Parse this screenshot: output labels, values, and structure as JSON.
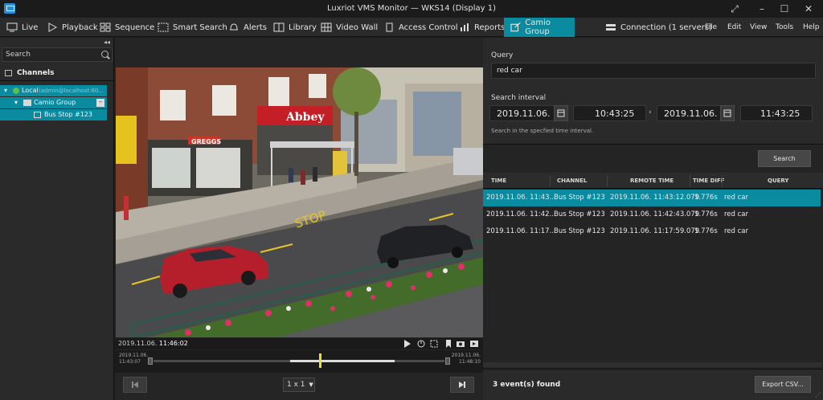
{
  "window": {
    "title": "Luxriot VMS Monitor — WKS14 (Display 1)"
  },
  "menu": {
    "tabs": [
      {
        "label": "Live",
        "icon": "monitor-icon"
      },
      {
        "label": "Playback",
        "icon": "play-icon"
      },
      {
        "label": "Sequence",
        "icon": "grid-icon"
      },
      {
        "label": "Smart Search",
        "icon": "smart-search-icon"
      },
      {
        "label": "Alerts",
        "icon": "bell-icon"
      },
      {
        "label": "Library",
        "icon": "library-icon"
      },
      {
        "label": "Video Wall",
        "icon": "video-wall-icon"
      },
      {
        "label": "Access Control",
        "icon": "door-icon"
      },
      {
        "label": "Reports",
        "icon": "chart-icon"
      },
      {
        "label": "Camio Group",
        "icon": "external-link-icon"
      }
    ],
    "connection": "Connection (1 servers)",
    "menus": [
      "File",
      "Edit",
      "View",
      "Tools",
      "Help"
    ]
  },
  "sidebar": {
    "search_placeholder": "Search",
    "channels_label": "Channels",
    "tree": [
      {
        "label": "Local",
        "sub": "(admin@localhost:60..."
      },
      {
        "label": "Camio Group"
      },
      {
        "label": "Bus Stop #123"
      }
    ]
  },
  "video": {
    "timestamp": {
      "date": "2019.11.06.",
      "time": "11:46:02"
    },
    "timeline": {
      "start_date": "2019.11.06.",
      "start_time": "11:43:07",
      "end_date": "2019.11.06.",
      "end_time": "11:48:10"
    },
    "layout": "1 x 1",
    "scene_signs": {
      "shop": "Abbey",
      "store": "GREGGS"
    }
  },
  "form": {
    "query_label": "Query",
    "query_value": "red car",
    "interval_label": "Search interval",
    "from_date": "2019.11.06.",
    "from_time": "10:43:25",
    "to_date": "2019.11.06.",
    "to_time": "11:43:25",
    "hint": "Search in the specfied time interval.",
    "search_button": "Search"
  },
  "table": {
    "headers": [
      "TIME",
      "CHANNEL",
      "REMOTE TIME",
      "TIME DIFF",
      "QUERY"
    ],
    "rows": [
      {
        "time": "2019.11.06. 11:43...",
        "channel": "Bus Stop #123",
        "remote": "2019.11.06. 11:43:12.079",
        "diff": "1.776s",
        "query": "red car"
      },
      {
        "time": "2019.11.06. 11:42...",
        "channel": "Bus Stop #123",
        "remote": "2019.11.06. 11:42:43.079",
        "diff": "1.776s",
        "query": "red car"
      },
      {
        "time": "2019.11.06. 11:17...",
        "channel": "Bus Stop #123",
        "remote": "2019.11.06. 11:17:59.079",
        "diff": "1.776s",
        "query": "red car"
      }
    ]
  },
  "footer": {
    "count": "3 event(s) found",
    "export_button": "Export CSV..."
  }
}
